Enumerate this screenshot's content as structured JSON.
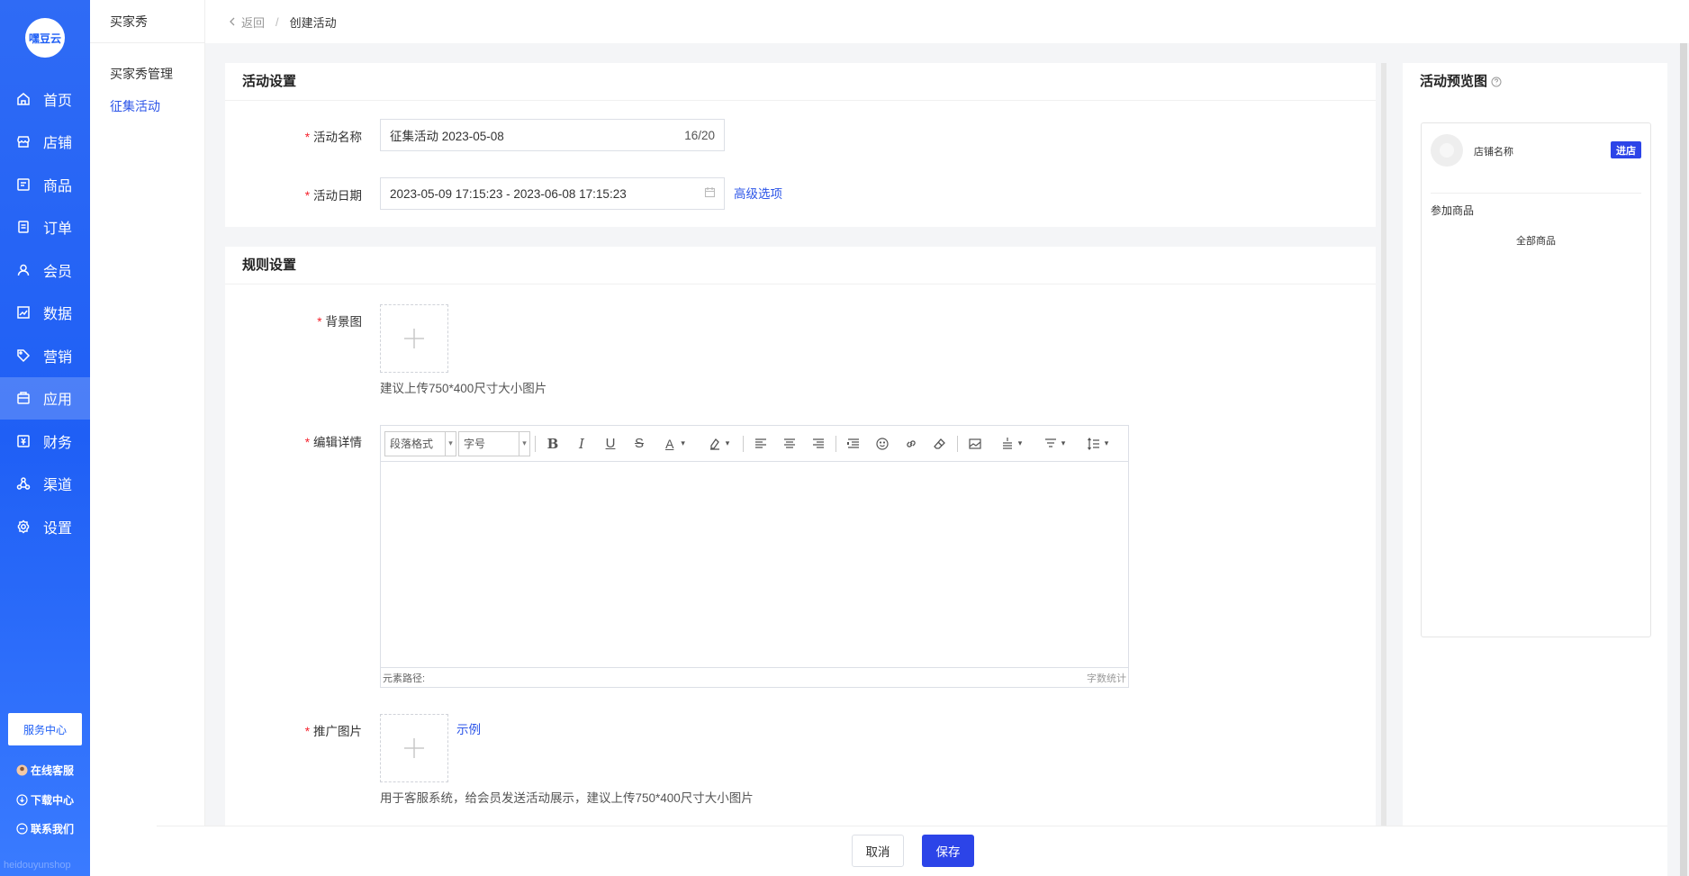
{
  "brand": {
    "logo_text": "嘿豆云",
    "watermark": "heidouyunshop"
  },
  "nav": {
    "items": [
      {
        "label": "首页",
        "icon": "home-icon"
      },
      {
        "label": "店铺",
        "icon": "store-icon"
      },
      {
        "label": "商品",
        "icon": "goods-icon"
      },
      {
        "label": "订单",
        "icon": "order-icon"
      },
      {
        "label": "会员",
        "icon": "user-icon"
      },
      {
        "label": "数据",
        "icon": "chart-icon"
      },
      {
        "label": "营销",
        "icon": "tag-icon"
      },
      {
        "label": "应用",
        "icon": "app-icon",
        "active": true
      },
      {
        "label": "财务",
        "icon": "finance-icon"
      },
      {
        "label": "渠道",
        "icon": "channel-icon"
      },
      {
        "label": "设置",
        "icon": "gear-icon"
      }
    ],
    "service_center": "服务中心",
    "online_service": "在线客服",
    "download_center": "下载中心",
    "contact_us": "联系我们"
  },
  "sub_nav": {
    "title": "买家秀",
    "items": [
      {
        "label": "买家秀管理",
        "active": false
      },
      {
        "label": "征集活动",
        "active": true
      }
    ]
  },
  "breadcrumb": {
    "back": "返回",
    "separator": "/",
    "current": "创建活动"
  },
  "activity_settings": {
    "title": "活动设置",
    "name_label": "活动名称",
    "name_value": "征集活动  2023-05-08",
    "name_count": "16/20",
    "date_label": "活动日期",
    "date_value": "2023-05-09 17:15:23 - 2023-06-08 17:15:23",
    "advanced_link": "高级选项"
  },
  "rule_settings": {
    "title": "规则设置",
    "bg_label": "背景图",
    "bg_hint": "建议上传750*400尺寸大小图片",
    "detail_label": "编辑详情",
    "editor": {
      "format_select": "段落格式",
      "size_select": "字号",
      "path_label": "元素路径:",
      "word_count": "字数统计"
    },
    "promo_label": "推广图片",
    "promo_example": "示例",
    "promo_hint": "用于客服系统，给会员发送活动展示，建议上传750*400尺寸大小图片"
  },
  "preview": {
    "title": "活动预览图",
    "shop_name": "店铺名称",
    "enter_button": "进店",
    "goods_label": "参加商品",
    "all_goods": "全部商品"
  },
  "footer": {
    "cancel": "取消",
    "save": "保存"
  },
  "colors": {
    "primary": "#2c44e8",
    "sidebar": "#1f5ff5",
    "required": "#f5222d"
  }
}
